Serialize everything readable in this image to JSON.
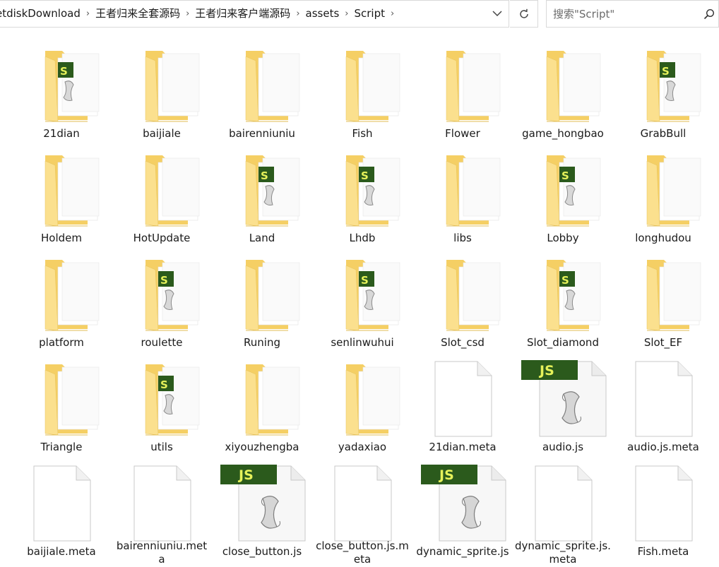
{
  "address_bar": {
    "crumbs": [
      "etdiskDownload",
      "王者归来全套源码",
      "王者归来客户端源码",
      "assets",
      "Script"
    ]
  },
  "search": {
    "placeholder": "搜索\"Script\""
  },
  "icons": {
    "dropdown": "chevron-down-icon",
    "refresh": "refresh-icon",
    "search": "search-icon",
    "folder": "folder-icon",
    "folder_js": "folder-with-js-icon",
    "blank_file": "blank-file-icon",
    "js_file": "js-file-icon"
  },
  "colors": {
    "folder_back": "#f5cf64",
    "folder_front": "#fbe08e",
    "js_badge": "#2b5a1c",
    "js_text": "#e6f25a"
  },
  "items": [
    {
      "name": "21dian",
      "type": "folder_js"
    },
    {
      "name": "baijiale",
      "type": "folder"
    },
    {
      "name": "bairenniuniu",
      "type": "folder"
    },
    {
      "name": "Fish",
      "type": "folder"
    },
    {
      "name": "Flower",
      "type": "folder"
    },
    {
      "name": "game_hongbao",
      "type": "folder"
    },
    {
      "name": "GrabBull",
      "type": "folder_js"
    },
    {
      "name": "Holdem",
      "type": "folder"
    },
    {
      "name": "HotUpdate",
      "type": "folder"
    },
    {
      "name": "Land",
      "type": "folder_js"
    },
    {
      "name": "Lhdb",
      "type": "folder_js"
    },
    {
      "name": "libs",
      "type": "folder"
    },
    {
      "name": "Lobby",
      "type": "folder_js"
    },
    {
      "name": "longhudou",
      "type": "folder"
    },
    {
      "name": "platform",
      "type": "folder"
    },
    {
      "name": "roulette",
      "type": "folder_js"
    },
    {
      "name": "Runing",
      "type": "folder"
    },
    {
      "name": "senlinwuhui",
      "type": "folder_js"
    },
    {
      "name": "Slot_csd",
      "type": "folder"
    },
    {
      "name": "Slot_diamond",
      "type": "folder_js"
    },
    {
      "name": "Slot_EF",
      "type": "folder"
    },
    {
      "name": "Triangle",
      "type": "folder"
    },
    {
      "name": "utils",
      "type": "folder_js"
    },
    {
      "name": "xiyouzhengba",
      "type": "folder"
    },
    {
      "name": "yadaxiao",
      "type": "folder"
    },
    {
      "name": "21dian.meta",
      "type": "file"
    },
    {
      "name": "audio.js",
      "type": "js"
    },
    {
      "name": "audio.js.meta",
      "type": "file"
    },
    {
      "name": "baijiale.meta",
      "type": "file"
    },
    {
      "name": "bairenniuniu.meta",
      "type": "file"
    },
    {
      "name": "close_button.js",
      "type": "js"
    },
    {
      "name": "close_button.js.meta",
      "type": "file"
    },
    {
      "name": "dynamic_sprite.js",
      "type": "js"
    },
    {
      "name": "dynamic_sprite.js.meta",
      "type": "file"
    },
    {
      "name": "Fish.meta",
      "type": "file"
    }
  ]
}
